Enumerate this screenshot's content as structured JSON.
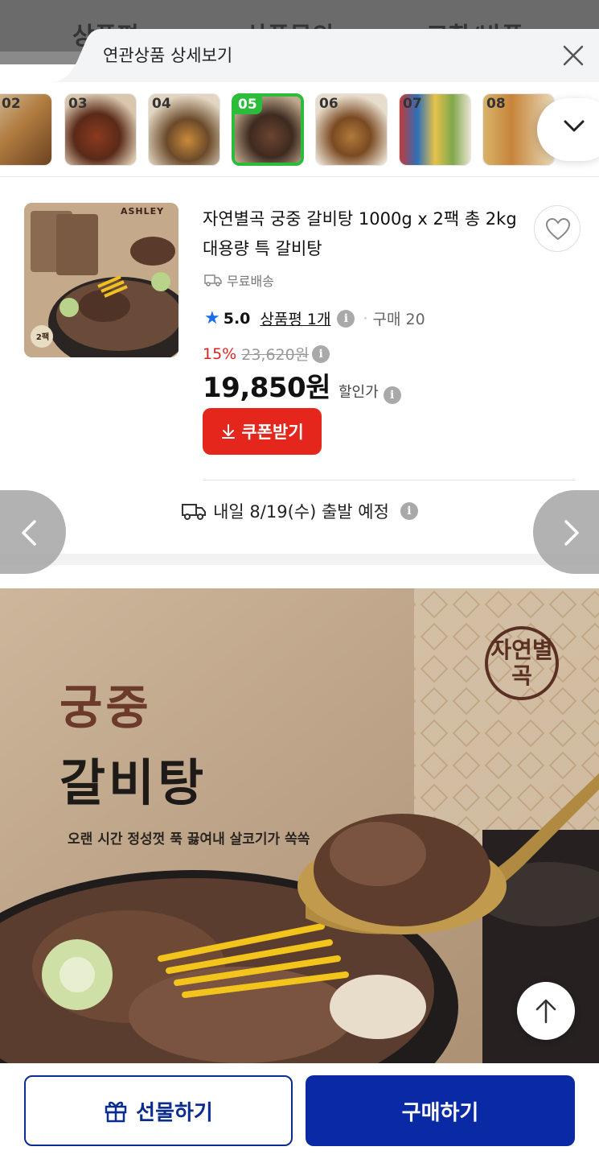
{
  "background_tabs": [
    "상품평",
    "상품문의",
    "교환/반품"
  ],
  "related": {
    "title": "연관상품 상세보기",
    "thumbnails": [
      {
        "num": "02",
        "active": false
      },
      {
        "num": "03",
        "active": false
      },
      {
        "num": "04",
        "active": false
      },
      {
        "num": "05",
        "active": true
      },
      {
        "num": "06",
        "active": false
      },
      {
        "num": "07",
        "active": false
      },
      {
        "num": "08",
        "active": false
      }
    ]
  },
  "product": {
    "title": "자연별곡 궁중 갈비탕 1000g x 2팩 총 2kg 대용량 특 갈비탕",
    "shipping": "무료배송",
    "rating": "5.0",
    "review_link": "상품평 1개",
    "purchase": "구매 20",
    "discount_pct": "15%",
    "original_price": "23,620원",
    "price": "19,850원",
    "price_label": "할인가",
    "coupon_label": "쿠폰받기",
    "delivery": "내일 8/19(수) 출발 예정",
    "image_badges": {
      "brand": "ASHLEY",
      "pack": "2팩"
    }
  },
  "banner": {
    "line1": "궁중",
    "line2": "갈비탕",
    "subtitle": "오랜 시간 정성껏 푹 끓여내 살코기가 쏙쏙",
    "logo_text": "자연별곡"
  },
  "bottom": {
    "gift_label": "선물하기",
    "buy_label": "구매하기"
  },
  "colors": {
    "accent_blue": "#0a2aa5",
    "coupon_red": "#e4261c",
    "active_green": "#2bbd3a",
    "star_blue": "#1a6fe6"
  }
}
